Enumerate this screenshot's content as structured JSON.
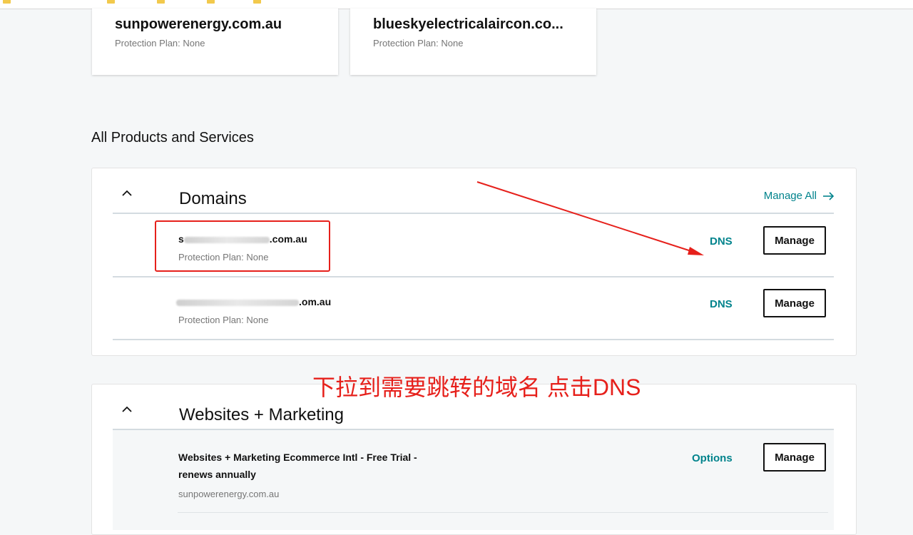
{
  "top_cards": [
    {
      "domain": "sunpowerenergy.com.au",
      "plan": "Protection Plan: None"
    },
    {
      "domain": "blueskyelectricalaircon.co...",
      "plan": "Protection Plan: None"
    }
  ],
  "section_heading": "All Products and Services",
  "domains_panel": {
    "title": "Domains",
    "manage_all": "Manage All",
    "rows": [
      {
        "name_prefix": "s",
        "name_suffix": ".com.au",
        "plan": "Protection Plan: None",
        "dns_label": "DNS",
        "manage_label": "Manage"
      },
      {
        "name_prefix": "",
        "name_suffix": ".om.au",
        "plan": "Protection Plan: None",
        "dns_label": "DNS",
        "manage_label": "Manage"
      }
    ]
  },
  "annotation": {
    "note": "下拉到需要跳转的域名  点击DNS",
    "color": "#e6201b"
  },
  "websites_panel": {
    "title": "Websites + Marketing",
    "row": {
      "name_line1": "Websites + Marketing Ecommerce Intl - Free Trial -",
      "name_line2": "renews annually",
      "domain": "sunpowerenergy.com.au",
      "options_label": "Options",
      "manage_label": "Manage"
    }
  },
  "colors": {
    "accent": "#00838c",
    "annotation_red": "#e6201b"
  }
}
